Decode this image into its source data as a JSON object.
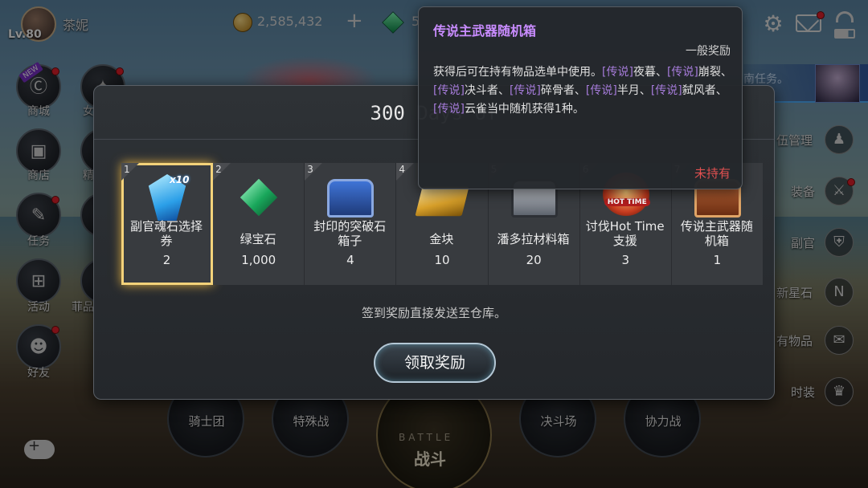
{
  "player": {
    "level": "Lv.80",
    "name": "茶妮"
  },
  "stats": {
    "gold": "2,585,432",
    "gem_partial": "5"
  },
  "left_menu": [
    {
      "label": "商城"
    },
    {
      "label": "商店"
    },
    {
      "label": "任务"
    },
    {
      "label": "活动"
    },
    {
      "label": "好友"
    }
  ],
  "left_menu2": [
    {
      "label": "女"
    },
    {
      "label": "精"
    },
    {
      "label": "菲品卡"
    }
  ],
  "new_badge": "NEW",
  "right_menu": [
    {
      "label": "伍管理"
    },
    {
      "label": "装备"
    },
    {
      "label": "副官"
    },
    {
      "label": "新星石"
    },
    {
      "label": "有物品"
    },
    {
      "label": "时装"
    }
  ],
  "quest": {
    "text": "南任务。"
  },
  "bottom_nav": [
    {
      "label": "骑士团"
    },
    {
      "label": "特殊战"
    },
    {
      "label": "决斗场"
    },
    {
      "label": "协力战"
    }
  ],
  "battle": {
    "en": "BATTLE",
    "cn": "战斗"
  },
  "modal": {
    "title": "300 Days of",
    "notice": "签到奖励直接发送至仓库。",
    "claim_label": "领取奖励"
  },
  "rewards": [
    {
      "day": "1",
      "name": "副官魂石选择券",
      "count": "2",
      "icon": "soul-stone-icon",
      "badge": "x10"
    },
    {
      "day": "2",
      "name": "绿宝石",
      "count": "1,000",
      "icon": "emerald-icon"
    },
    {
      "day": "3",
      "name": "封印的突破石箱子",
      "count": "4",
      "icon": "sealed-chest-icon"
    },
    {
      "day": "4",
      "name": "金块",
      "count": "10",
      "icon": "gold-bar-icon"
    },
    {
      "day": "5",
      "name": "潘多拉材料箱",
      "count": "20",
      "icon": "pandora-chest-icon"
    },
    {
      "day": "6",
      "name": "讨伐Hot Time支援",
      "count": "3",
      "icon": "hot-time-icon",
      "badge": "HOT TIME"
    },
    {
      "day": "7",
      "name": "传说主武器随机箱",
      "count": "1",
      "icon": "legend-weapon-chest-icon"
    }
  ],
  "tooltip": {
    "title": "传说主武器随机箱",
    "category": "一般奖励",
    "desc_prefix": "获得后可在持有物品选单中使用。",
    "tag": "[传说]",
    "items": [
      "夜暮",
      "崩裂",
      "决斗者",
      "碎骨者",
      "半月",
      "弑风者",
      "云雀"
    ],
    "desc_suffix": "当中随机获得1种。",
    "owned_status": "未持有"
  }
}
